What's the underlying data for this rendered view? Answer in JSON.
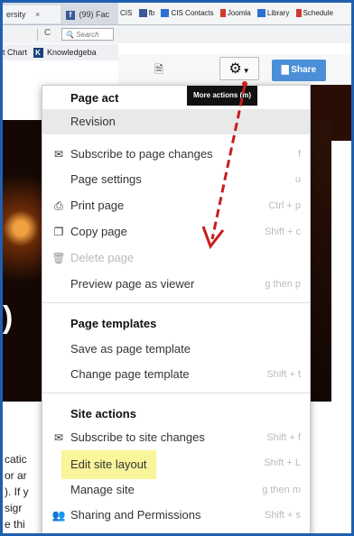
{
  "browser": {
    "tabs": {
      "active_label": "ersity",
      "close": "×",
      "fb_label": "(99) Fac"
    },
    "bookmarks": [
      {
        "label": "CIS",
        "color": ""
      },
      {
        "label": "fb",
        "color": "#3b5998"
      },
      {
        "label": "CIS Contacts",
        "color": "#2d6fd6"
      },
      {
        "label": "Joomla",
        "color": "#d03a2f"
      },
      {
        "label": "Library",
        "color": "#2d6fd6"
      },
      {
        "label": "Schedule",
        "color": "#d03a2f"
      }
    ],
    "reload_glyph": "C",
    "search_placeholder": "Search",
    "bm_left": {
      "chart_label": "t Chart",
      "k_label": "Knowledgeba"
    }
  },
  "page_toolbar": {
    "share_label": "Share",
    "tooltip": "More actions (m)"
  },
  "menu": {
    "items": [
      {
        "label": "Page act",
        "type": "heading",
        "shortcut": ""
      },
      {
        "label": "Revision",
        "type": "revision",
        "shortcut": ""
      },
      {
        "label": "Subscribe to page changes",
        "type": "item",
        "icon": "mail-icon",
        "glyph": "✉",
        "shortcut": "f"
      },
      {
        "label": "Page settings",
        "type": "item",
        "icon": "",
        "glyph": "",
        "shortcut": "u"
      },
      {
        "label": "Print page",
        "type": "item",
        "icon": "print-icon",
        "glyph": "⎙",
        "shortcut": "Ctrl + p"
      },
      {
        "label": "Copy page",
        "type": "item",
        "icon": "copy-icon",
        "glyph": "❐",
        "shortcut": "Shift + c"
      },
      {
        "label": "Delete page",
        "type": "disabled",
        "icon": "trash-icon",
        "glyph": "🗑",
        "shortcut": ""
      },
      {
        "label": "Preview page as viewer",
        "type": "item",
        "icon": "",
        "glyph": "",
        "shortcut": "g then p"
      },
      {
        "label": "Page templates",
        "type": "heading",
        "shortcut": ""
      },
      {
        "label": "Save as page template",
        "type": "item",
        "icon": "",
        "glyph": "",
        "shortcut": ""
      },
      {
        "label": "Change page template",
        "type": "item",
        "icon": "",
        "glyph": "",
        "shortcut": "Shift + t"
      },
      {
        "label": "Site actions",
        "type": "heading",
        "shortcut": ""
      },
      {
        "label": "Subscribe to site changes",
        "type": "item",
        "icon": "mail-icon",
        "glyph": "✉",
        "shortcut": "Shift + f"
      },
      {
        "label": "Edit site layout",
        "type": "highlight",
        "icon": "",
        "glyph": "",
        "shortcut": "Shift + L"
      },
      {
        "label": "Manage site",
        "type": "item",
        "icon": "",
        "glyph": "",
        "shortcut": "g then m"
      },
      {
        "label": "Sharing and Permissions",
        "type": "item",
        "icon": "add-user-icon",
        "glyph": "👥",
        "shortcut": "Shift + s"
      }
    ]
  },
  "background_text": {
    "lines": [
      "catic",
      "or ar",
      "). If y",
      "sigr",
      "e thi"
    ]
  }
}
